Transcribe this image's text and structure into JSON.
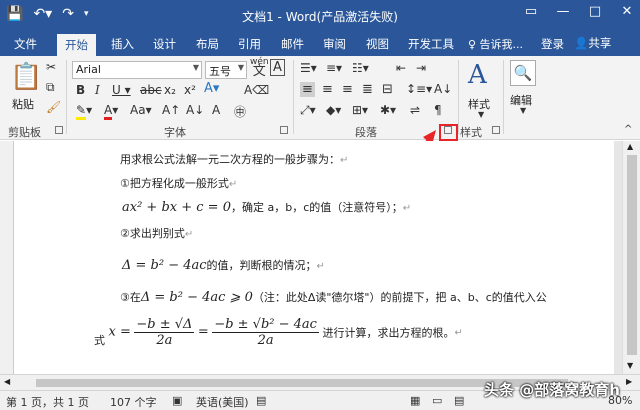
{
  "app": {
    "title": "文档1 - Word(产品激活失败)"
  },
  "qat": {
    "save_icon": "save-icon",
    "undo_icon": "undo-icon",
    "redo_icon": "redo-icon",
    "customize_icon": "customize-icon"
  },
  "window": {
    "restore": "▭",
    "minimize": "—",
    "maximize": "□",
    "close": "✕"
  },
  "tabs": [
    "文件",
    "开始",
    "插入",
    "设计",
    "布局",
    "引用",
    "邮件",
    "审阅",
    "视图",
    "开发工具"
  ],
  "active_tab": "开始",
  "tellme": "♀ 告诉我...",
  "login": "登录",
  "share": "共享",
  "ribbon": {
    "clipboard": {
      "paste": "粘贴",
      "label": "剪贴板"
    },
    "font": {
      "name": "Arial",
      "size": "五号",
      "label": "字体",
      "wen": "wén",
      "wen_char": "文",
      "A_box": "A"
    },
    "paragraph": {
      "label": "段落"
    },
    "styles": {
      "button": "样式",
      "label": "样式"
    },
    "editing": {
      "button": "编辑"
    }
  },
  "document": {
    "line1": "用求根公式法解一元二次方程的一般步骤为：",
    "line2": "①把方程化成一般形式",
    "line3_math": "ax² + bx + c = 0",
    "line3_text": "，确定 a，b，c的值（注意符号）；",
    "line4": "②求出判别式",
    "line5_math": "Δ = b² − 4ac",
    "line5_text": "的值，判断根的情况；",
    "line6_pre": "③在",
    "line6_math": "Δ = b² − 4ac ⩾ 0",
    "line6_text": "（注：此处Δ读\"德尔塔\"）的前提下，把 a、b、c的值代入公",
    "line7_pre": "式",
    "line7_x": "x =",
    "frac1_num": "−b ± √Δ",
    "frac1_den": "2a",
    "eq": "=",
    "frac2_num": "−b ± √b² − 4ac",
    "frac2_den": "2a",
    "line7_text": "进行计算，求出方程的根。",
    "para_mark": "↵"
  },
  "status": {
    "page": "第 1 页，共 1 页",
    "words": "107 个字",
    "lang": "英语(美国)",
    "zoom": "80%"
  },
  "watermark": "头条 @部落窝教育h"
}
